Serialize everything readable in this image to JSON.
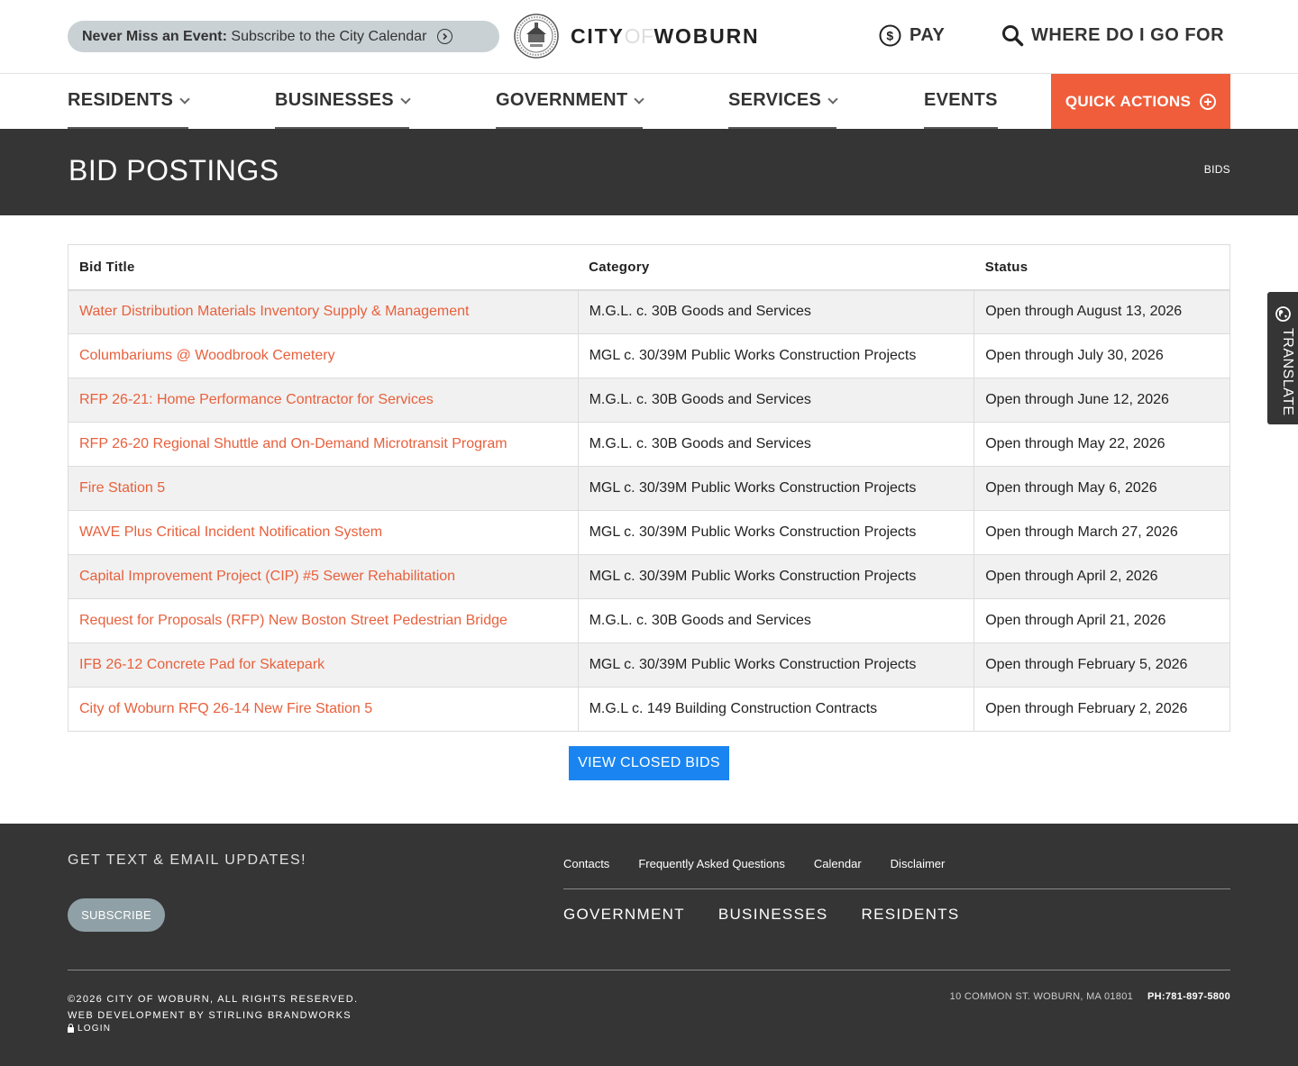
{
  "header": {
    "promo_bold": "Never Miss an Event:",
    "promo_text": "Subscribe to the City Calendar",
    "logo_city": "CITY",
    "logo_of": "OF",
    "logo_name": "WOBURN",
    "pay_label": "PAY",
    "where_label": "WHERE DO I GO FOR"
  },
  "nav": {
    "residents": "RESIDENTS",
    "businesses": "BUSINESSES",
    "government": "GOVERNMENT",
    "services": "SERVICES",
    "events": "EVENTS",
    "quick_actions": "QUICK ACTIONS"
  },
  "page": {
    "title": "BID POSTINGS",
    "breadcrumb": "BIDS"
  },
  "table": {
    "headers": [
      "Bid Title",
      "Category",
      "Status"
    ],
    "rows": [
      {
        "title": "Water Distribution Materials Inventory Supply & Management",
        "category": "M.G.L. c. 30B Goods and Services",
        "status": "Open through August 13, 2026"
      },
      {
        "title": "Columbariums @ Woodbrook Cemetery",
        "category": "MGL c. 30/39M Public Works Construction Projects",
        "status": "Open through July 30, 2026"
      },
      {
        "title": "RFP 26-21: Home Performance Contractor for Services",
        "category": "M.G.L. c. 30B Goods and Services",
        "status": "Open through June 12, 2026"
      },
      {
        "title": "RFP 26-20 Regional Shuttle and On-Demand Microtransit Program",
        "category": "M.G.L. c. 30B Goods and Services",
        "status": "Open through May 22, 2026"
      },
      {
        "title": "Fire Station 5",
        "category": "MGL c. 30/39M Public Works Construction Projects",
        "status": "Open through May 6, 2026"
      },
      {
        "title": "WAVE Plus Critical Incident Notification System",
        "category": "MGL c. 30/39M Public Works Construction Projects",
        "status": "Open through March 27, 2026"
      },
      {
        "title": "Capital Improvement Project (CIP) #5 Sewer Rehabilitation",
        "category": "MGL c. 30/39M Public Works Construction Projects",
        "status": "Open through April 2, 2026"
      },
      {
        "title": "Request for Proposals (RFP) New Boston Street Pedestrian Bridge",
        "category": "M.G.L. c. 30B Goods and Services",
        "status": "Open through April 21, 2026"
      },
      {
        "title": "IFB 26-12 Concrete Pad for Skatepark",
        "category": "MGL c. 30/39M Public Works Construction Projects",
        "status": "Open through February 5, 2026"
      },
      {
        "title": "City of Woburn RFQ 26-14 New Fire Station 5",
        "category": "M.G.L c. 149 Building Construction Contracts",
        "status": "Open through February 2, 2026"
      }
    ]
  },
  "closed_bids_label": "VIEW CLOSED BIDS",
  "translate_label": "TRANSLATE",
  "footer": {
    "updates_title": "GET TEXT & EMAIL UPDATES!",
    "subscribe_label": "SUBSCRIBE",
    "links": [
      "Contacts",
      "Frequently Asked Questions",
      "Calendar",
      "Disclaimer"
    ],
    "nav": [
      "GOVERNMENT",
      "BUSINESSES",
      "RESIDENTS"
    ],
    "copyright": "©2026 CITY OF WOBURN, ALL RIGHTS RESERVED.",
    "credit": "WEB DEVELOPMENT BY STIRLING BRANDWORKS",
    "login": "LOGIN",
    "address": "10 COMMON ST. WOBURN, MA 01801",
    "phone": "PH:781-897-5800"
  },
  "colors": {
    "accent": "#ef5d3b",
    "link": "#e8603c",
    "button_blue": "#1a85f0",
    "dark": "#353535",
    "promo_bg": "#c9d1d4"
  },
  "icons": {
    "promo": "arrow-circle-right-icon",
    "pay": "dollar-circle-icon",
    "where": "search-icon",
    "quick": "plus-circle-icon",
    "translate": "globe-icon",
    "login": "lock-icon"
  }
}
